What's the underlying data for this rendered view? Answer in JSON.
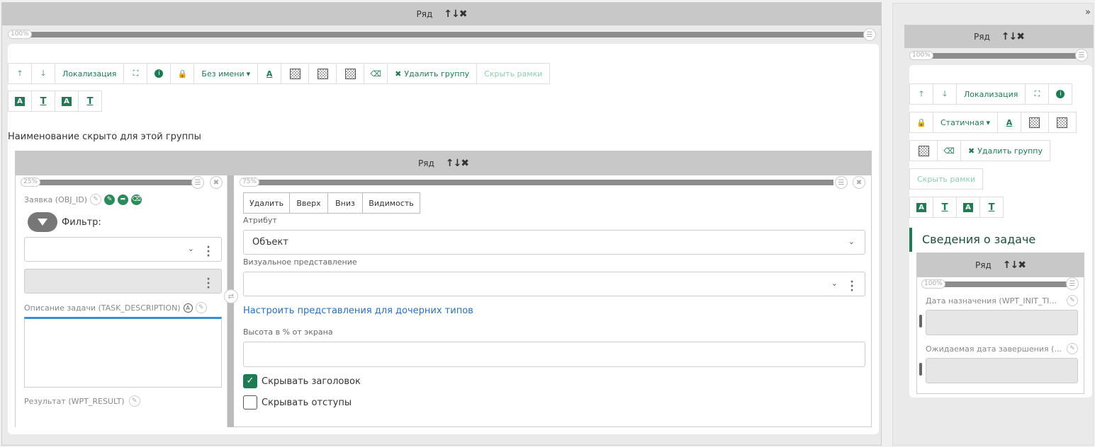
{
  "main": {
    "row_title": "Ряд",
    "row_ctrls": "↑↓✖",
    "pct": "100%",
    "toolbar": {
      "localization": "Локализация",
      "no_name": "Без имени",
      "delete_group": "Удалить группу",
      "hide_frames": "Скрыть рамки"
    },
    "group_hidden_text": "Наименование скрыто для этой группы",
    "inner": {
      "row_title": "Ряд",
      "row_ctrls": "↑↓✖",
      "left": {
        "pct": "25%",
        "request_label": "Заявка (OBJ_ID)",
        "filter_label": "Фильтр:",
        "desc_label": "Описание задачи (TASK_DESCRIPTION)",
        "result_label": "Результат (WPT_RESULT)"
      },
      "right": {
        "pct": "75%",
        "buttons": [
          "Удалить",
          "Вверх",
          "Вниз",
          "Видимость"
        ],
        "attr_label": "Атрибут",
        "attr_value": "Объект",
        "visual_label": "Визуальное представление",
        "config_link": "Настроить представления для дочерних типов",
        "height_label": "Высота в % от экрана",
        "hide_header": "Скрывать заголовок",
        "hide_padding": "Скрывать отступы"
      }
    }
  },
  "side": {
    "collapse": "»",
    "row_title": "Ряд",
    "row_ctrls": "↑↓✖",
    "pct": "100%",
    "toolbar": {
      "localization": "Локализация",
      "static": "Статичная",
      "delete_group": "Удалить группу",
      "hide_frames": "Скрыть рамки"
    },
    "section_title": "Сведения о задаче",
    "inner": {
      "row_title": "Ряд",
      "row_ctrls": "↑↓✖",
      "pct": "100%",
      "assign_label": "Дата назначения (WPT_INIT_TI...",
      "due_label": "Ожидаемая дата завершения (..."
    }
  },
  "colors": {
    "accent": "#1e7b53",
    "link": "#2b6fb6",
    "bar": "#8c8c8c"
  }
}
